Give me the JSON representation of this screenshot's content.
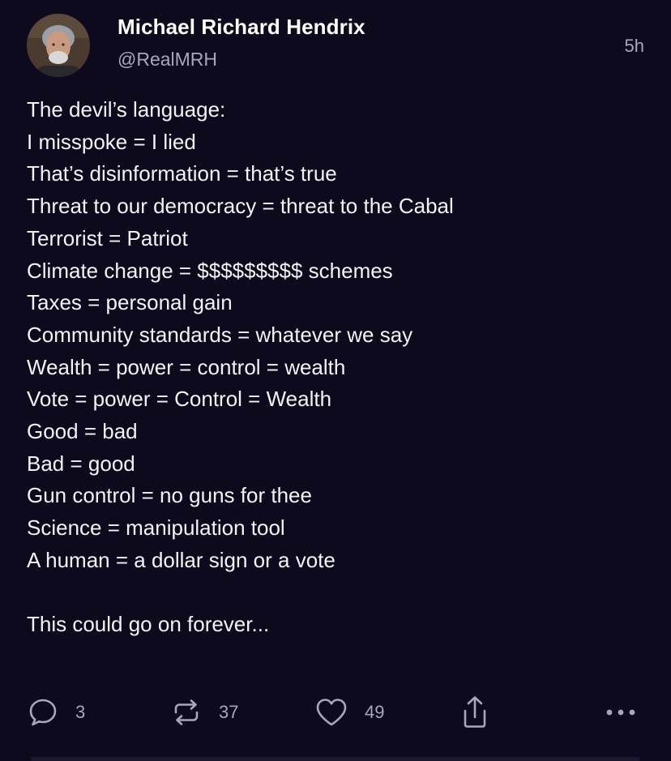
{
  "author": {
    "display_name": "Michael Richard Hendrix",
    "handle": "@RealMRH",
    "avatar_icon": "avatar-photo"
  },
  "post": {
    "time": "5h",
    "lines": [
      "The devil’s language:",
      "I misspoke = I lied",
      "That’s disinformation = that’s true",
      "Threat to our democracy = threat to the Cabal",
      "Terrorist = Patriot",
      "Climate change = $$$$$$$$$ schemes",
      "Taxes = personal gain",
      "Community standards = whatever we say",
      "Wealth = power = control = wealth",
      "Vote = power = Control = Wealth",
      "Good = bad",
      "Bad = good",
      "Gun control = no guns for thee",
      "Science = manipulation tool",
      "A human = a dollar sign or a vote",
      "",
      "This could go on forever..."
    ]
  },
  "actions": {
    "reply": {
      "icon": "reply-icon",
      "count": "3"
    },
    "repost": {
      "icon": "repost-icon",
      "count": "37"
    },
    "like": {
      "icon": "heart-icon",
      "count": "49"
    },
    "share": {
      "icon": "share-icon"
    },
    "more": {
      "icon": "more-icon"
    }
  },
  "colors": {
    "background": "#0d0a1d",
    "text": "#f3f2f7",
    "muted": "#a8a6b8"
  }
}
